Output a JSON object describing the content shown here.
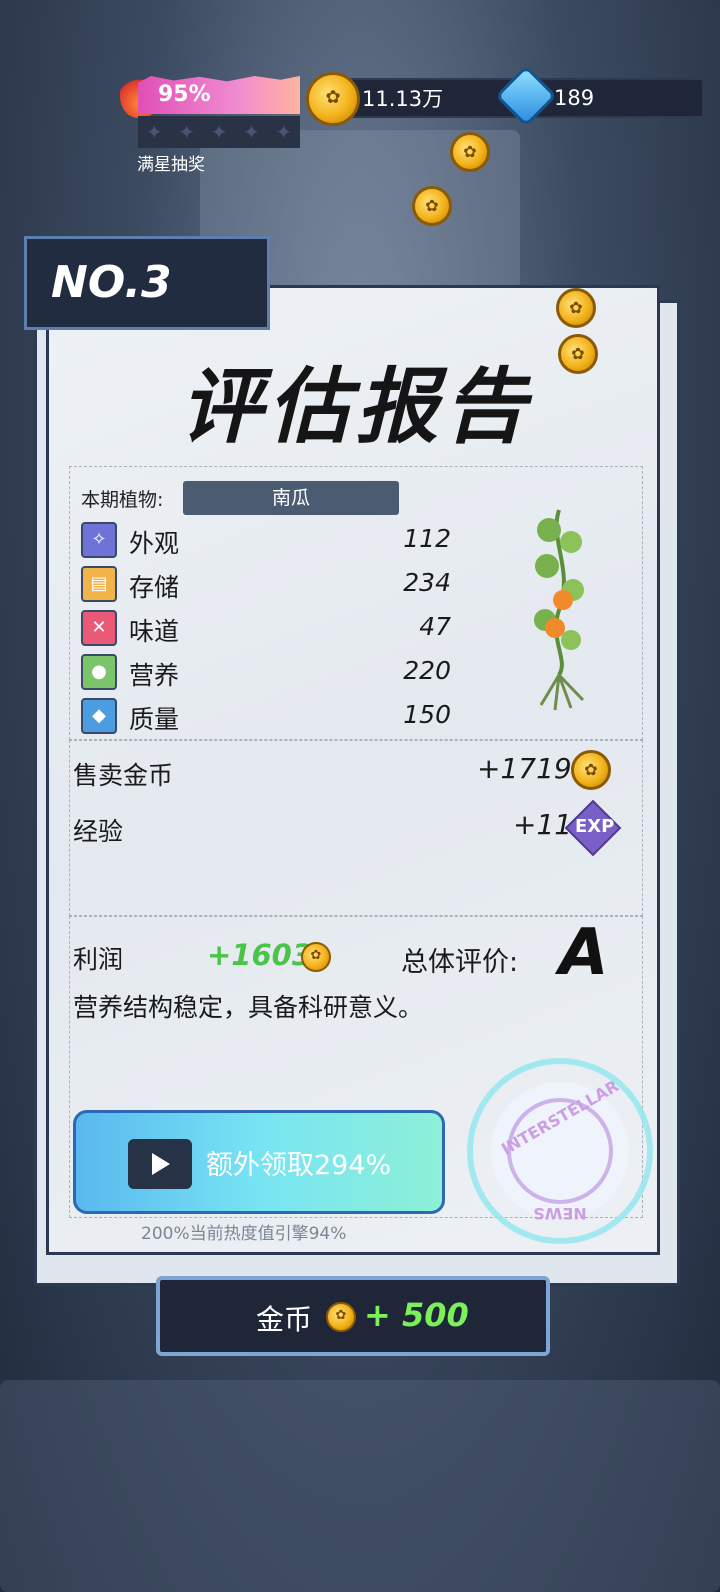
{
  "hud": {
    "heat_percent": "95%",
    "lottery_label": "满星抽奖",
    "gold": "11.13万",
    "gems": "189"
  },
  "report": {
    "number": "NO.3",
    "title": "评估报告",
    "plant_label": "本期植物:",
    "plant_name": "南瓜",
    "stats": [
      {
        "icon": "sparkle-icon",
        "label": "外观",
        "value": "112",
        "color": "#6f73d8"
      },
      {
        "icon": "storage-icon",
        "label": "存储",
        "value": "234",
        "color": "#f2b34a"
      },
      {
        "icon": "utensils-icon",
        "label": "味道",
        "value": "47",
        "color": "#ea5a77"
      },
      {
        "icon": "nutrition-icon",
        "label": "营养",
        "value": "220",
        "color": "#7bc46a"
      },
      {
        "icon": "muscle-icon",
        "label": "质量",
        "value": "150",
        "color": "#4b9de0"
      }
    ],
    "sell_label": "售卖金币",
    "sell_value": "+1719",
    "exp_label": "经验",
    "exp_value": "+11",
    "exp_badge": "EXP",
    "profit_label": "利润",
    "profit_value": "+1603",
    "grade_label": "总体评价:",
    "grade": "A",
    "comment": "营养结构稳定，具备科研意义。",
    "ad_button": "额外领取294%",
    "heat_note": "200%当前热度值引擎94%",
    "stamp_text": "INTERSTELLAR",
    "stamp_bottom": "NEWS"
  },
  "footer": {
    "coin_label": "金币",
    "coin_amount": "+ 500"
  }
}
